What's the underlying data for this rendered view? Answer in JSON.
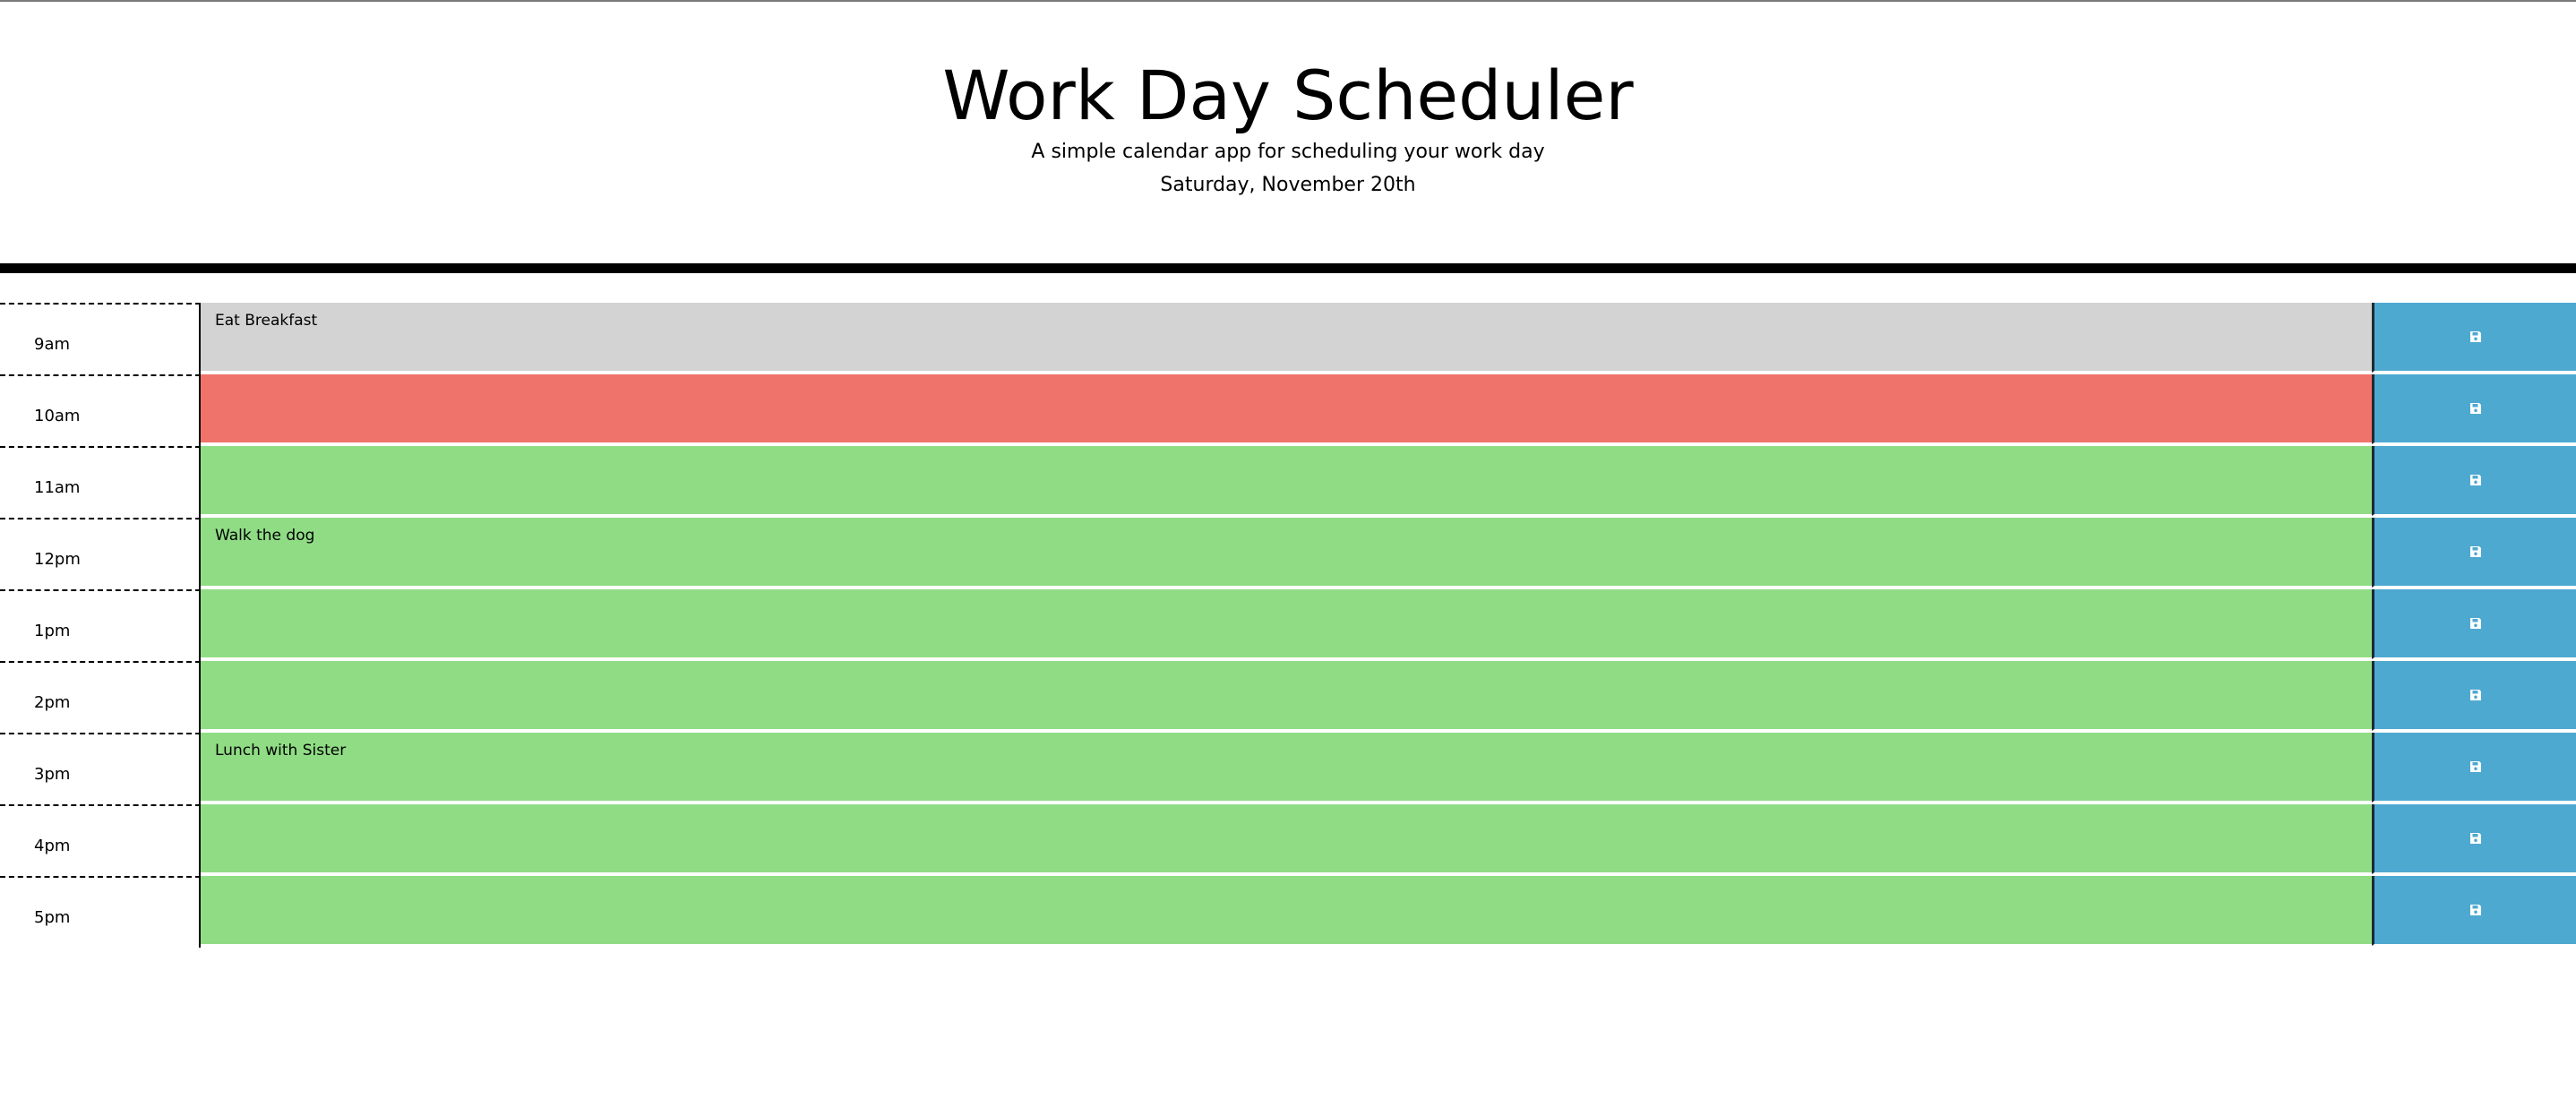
{
  "header": {
    "title": "Work Day Scheduler",
    "lead": "A simple calendar app for scheduling your work day",
    "current_day": "Saturday, November 20th"
  },
  "colors": {
    "past": "#d3d3d3",
    "present": "#ef736a",
    "future": "#90dc85",
    "save_button": "#4ea9d1"
  },
  "save_icon": "floppy-disk-icon",
  "time_blocks": [
    {
      "hour": "9am",
      "text": "Eat Breakfast",
      "state": "past"
    },
    {
      "hour": "10am",
      "text": "",
      "state": "present"
    },
    {
      "hour": "11am",
      "text": "",
      "state": "future"
    },
    {
      "hour": "12pm",
      "text": "Walk the dog",
      "state": "future"
    },
    {
      "hour": "1pm",
      "text": "",
      "state": "future"
    },
    {
      "hour": "2pm",
      "text": "",
      "state": "future"
    },
    {
      "hour": "3pm",
      "text": "Lunch with Sister",
      "state": "future"
    },
    {
      "hour": "4pm",
      "text": "",
      "state": "future"
    },
    {
      "hour": "5pm",
      "text": "",
      "state": "future"
    }
  ]
}
